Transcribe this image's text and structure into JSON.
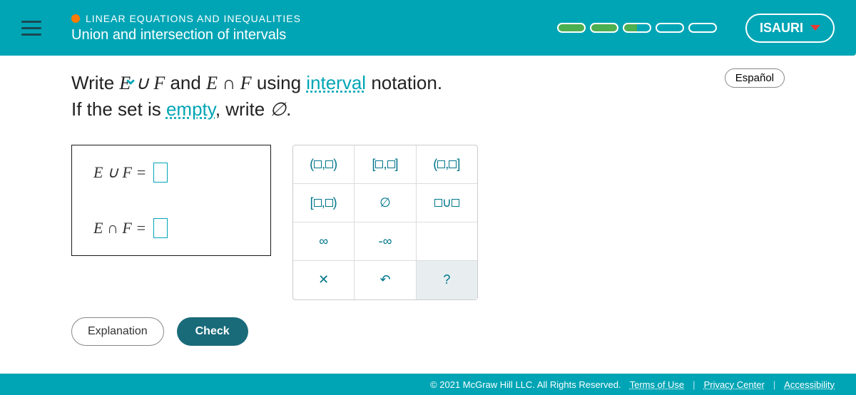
{
  "header": {
    "breadcrumb": "LINEAR EQUATIONS AND INEQUALITIES",
    "subtitle": "Union and intersection of intervals",
    "user": "ISAURI"
  },
  "language_button": "Español",
  "instruction": {
    "pre1": "Write ",
    "expr1a": "E",
    "expr1op": " ∪ ",
    "expr1b": "F",
    "mid1": " and ",
    "expr2a": "E",
    "expr2op": " ∩ ",
    "expr2b": "F",
    "mid2": " using ",
    "link1": "interval",
    "post1": " notation.",
    "line2a": "If the set is ",
    "link2": "empty",
    "line2b": ", write ",
    "emptysym": "∅",
    "line2c": "."
  },
  "answers": {
    "row1_label": "E ∪ F =",
    "row2_label": "E ∩ F ="
  },
  "keypad": {
    "r1c1": "(□,□)",
    "r1c2": "[□,□]",
    "r1c3": "(□,□]",
    "r2c1": "[□,□)",
    "r2c2": "∅",
    "r2c3": "□∪□",
    "r3c1": "∞",
    "r3c2": "-∞",
    "r4c1": "✕",
    "r4c2": "↶",
    "r4c3": "?"
  },
  "buttons": {
    "explanation": "Explanation",
    "check": "Check"
  },
  "footer": {
    "copyright": "© 2021 McGraw Hill LLC. All Rights Reserved.",
    "terms": "Terms of Use",
    "privacy": "Privacy Center",
    "accessibility": "Accessibility"
  }
}
